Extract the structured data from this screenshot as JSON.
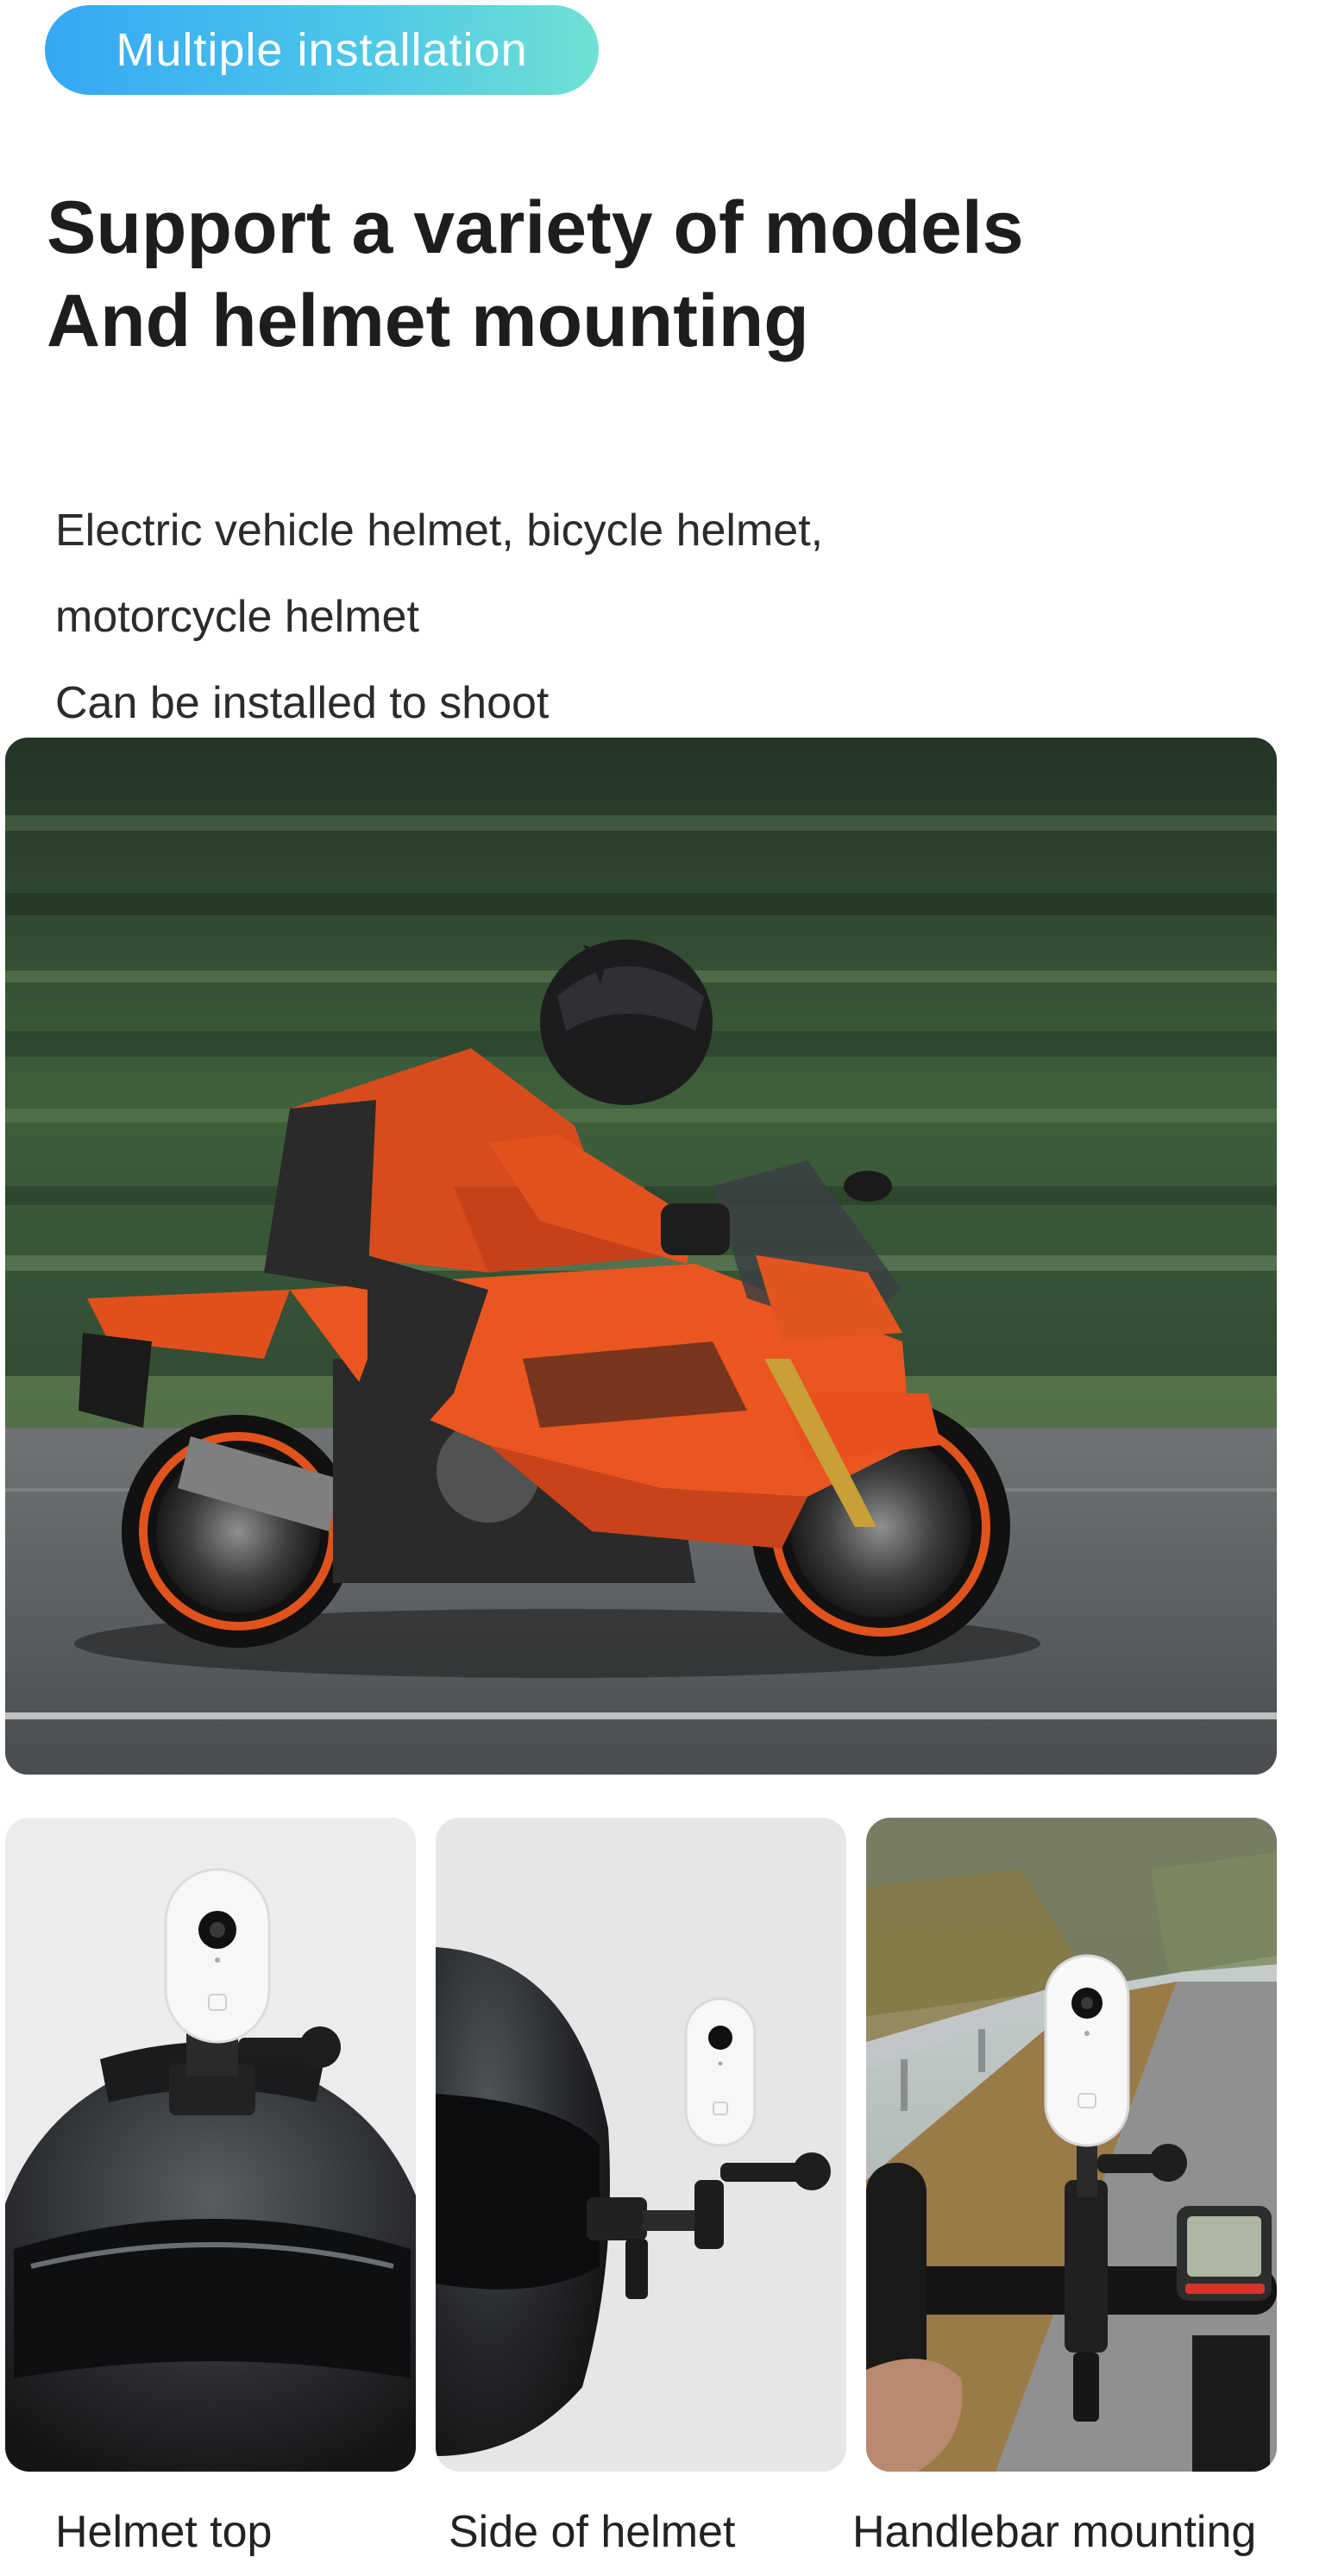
{
  "badge": {
    "label": "Multiple installation"
  },
  "headline": {
    "line1": "Support a variety of models",
    "line2": "And helmet mounting"
  },
  "description": {
    "line1": "Electric vehicle helmet, bicycle helmet,",
    "line2": "motorcycle helmet",
    "line3": "Can be installed to shoot"
  },
  "hero": {
    "image": "motorcycle-rider-photo"
  },
  "mounts": [
    {
      "caption": "Helmet top",
      "image": "camera-on-helmet-top"
    },
    {
      "caption": "Side of helmet",
      "image": "camera-on-helmet-side"
    },
    {
      "caption": "Handlebar mounting",
      "image": "camera-on-bike-handlebar"
    }
  ],
  "colors": {
    "badge_gradient_start": "#35a7f6",
    "badge_gradient_end": "#6fe1d3",
    "motorcycle": "#e8501e",
    "camera": "#f4f4f4"
  }
}
